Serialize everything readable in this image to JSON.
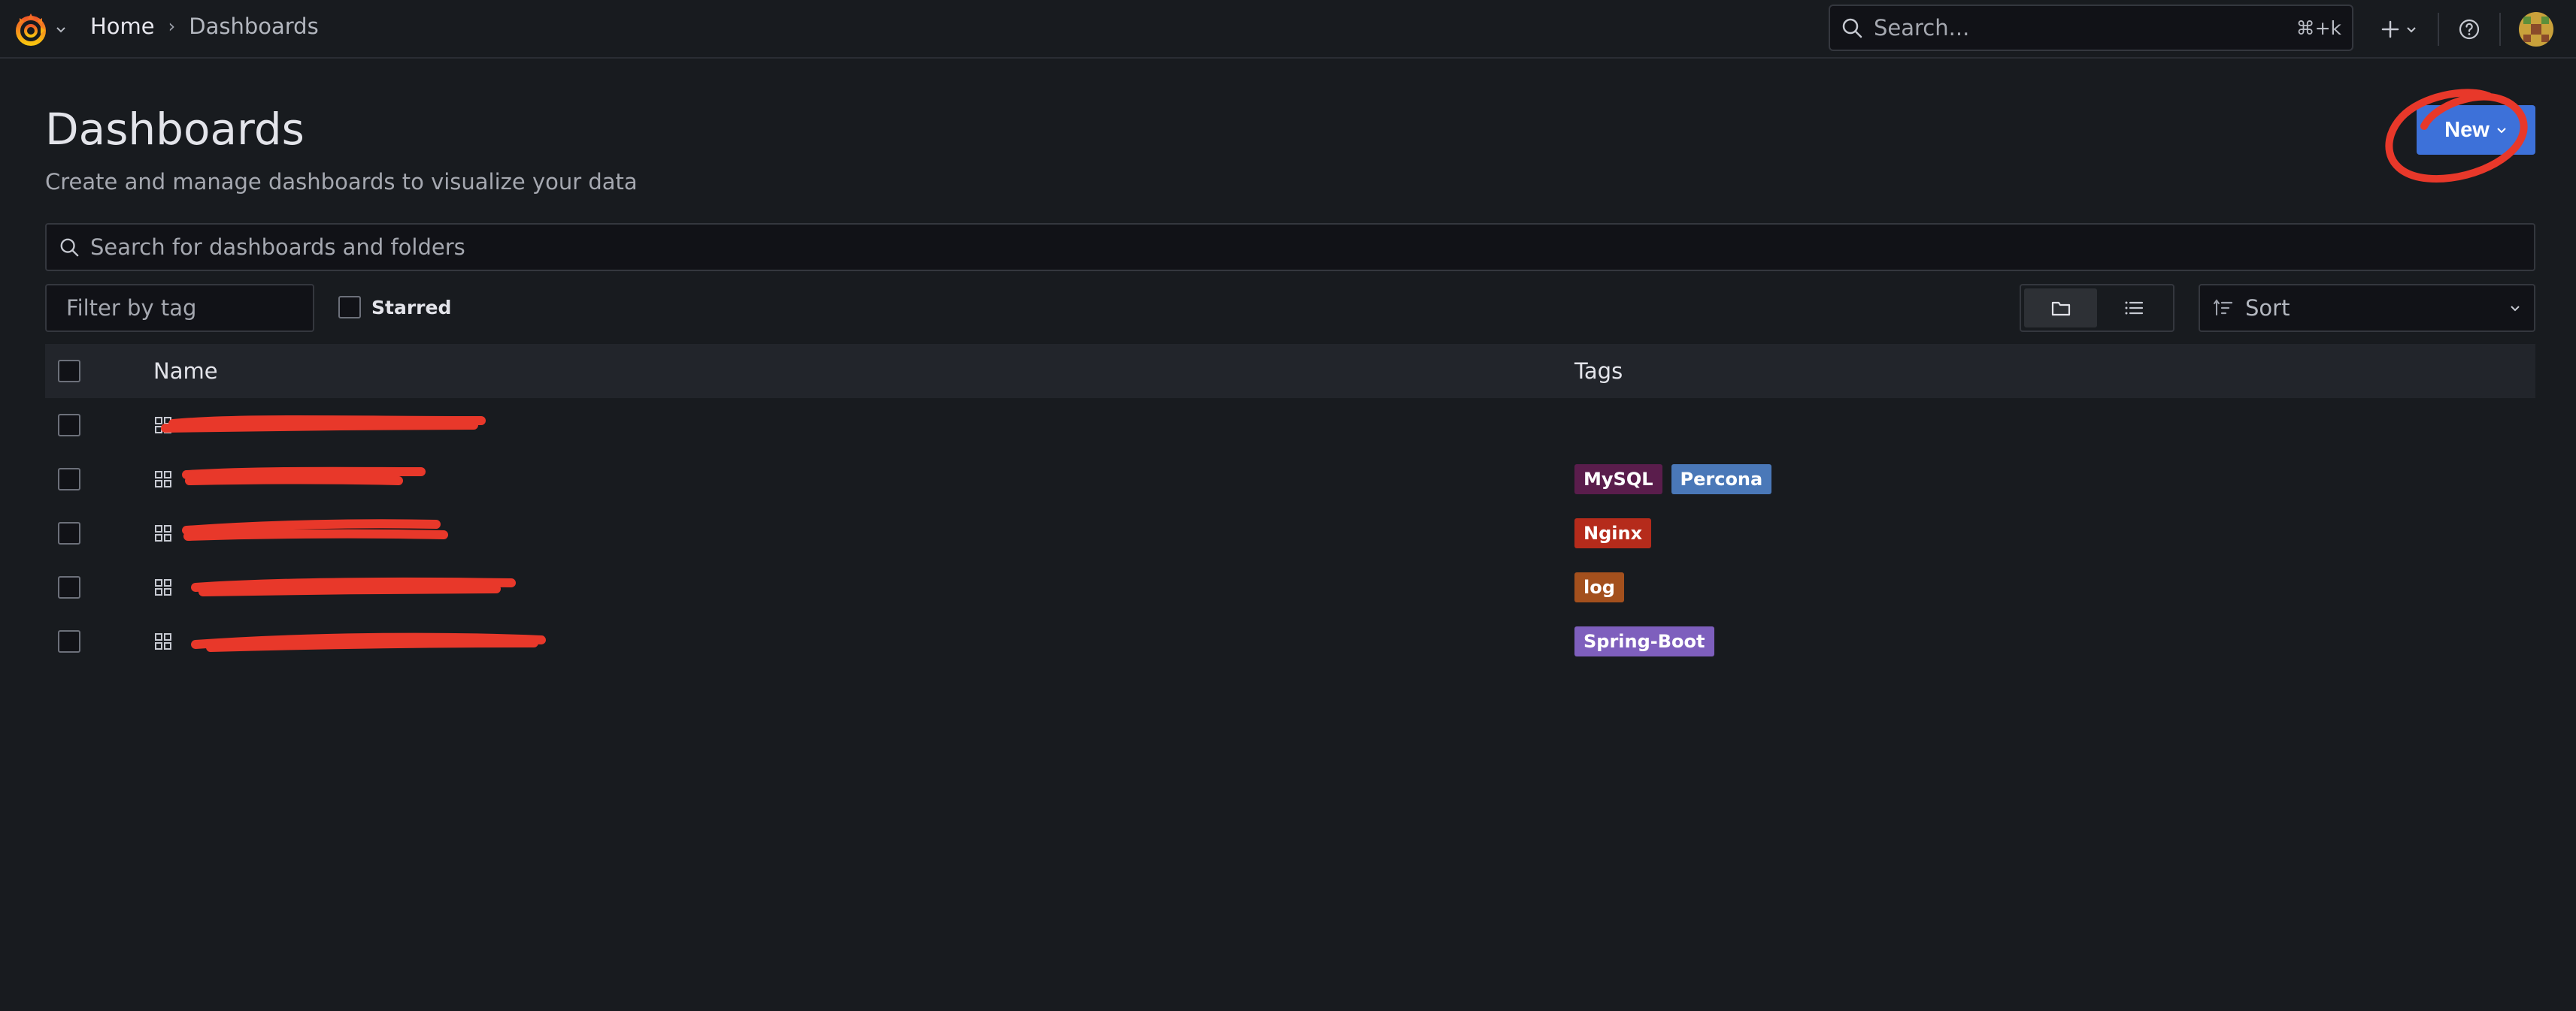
{
  "breadcrumb": {
    "home": "Home",
    "separator": "›",
    "current": "Dashboards"
  },
  "top_search": {
    "placeholder": "Search...",
    "shortcut": "⌘+k"
  },
  "page": {
    "title": "Dashboards",
    "subtitle": "Create and manage dashboards to visualize your data",
    "new_button": "New"
  },
  "search": {
    "placeholder": "Search for dashboards and folders"
  },
  "filters": {
    "tag_placeholder": "Filter by tag",
    "starred_label": "Starred",
    "sort_label": "Sort"
  },
  "table": {
    "columns": {
      "name": "Name",
      "tags": "Tags"
    },
    "rows": [
      {
        "name": "",
        "tags": []
      },
      {
        "name": "",
        "tags": [
          {
            "label": "MySQL",
            "color": "#5a1d4c"
          },
          {
            "label": "Percona",
            "color": "#4a78b8"
          }
        ]
      },
      {
        "name": "",
        "tags": [
          {
            "label": "Nginx",
            "color": "#b52b1b"
          }
        ]
      },
      {
        "name": "",
        "tags": [
          {
            "label": "log",
            "color": "#a3501d"
          }
        ]
      },
      {
        "name": "",
        "tags": [
          {
            "label": "Spring-Boot",
            "color": "#7e5fbd"
          }
        ]
      }
    ]
  },
  "colors": {
    "background": "#181b1f",
    "primary": "#3d71d9",
    "annotation": "#e8382a"
  },
  "icons": {
    "logo": "grafana-logo-icon",
    "search": "search-icon",
    "plus": "plus-icon",
    "help": "help-icon",
    "tag": "tag-icon",
    "folder_view": "folder-icon",
    "list_view": "list-icon",
    "sort": "sort-icon",
    "dashboard": "dashboard-grid-icon"
  }
}
